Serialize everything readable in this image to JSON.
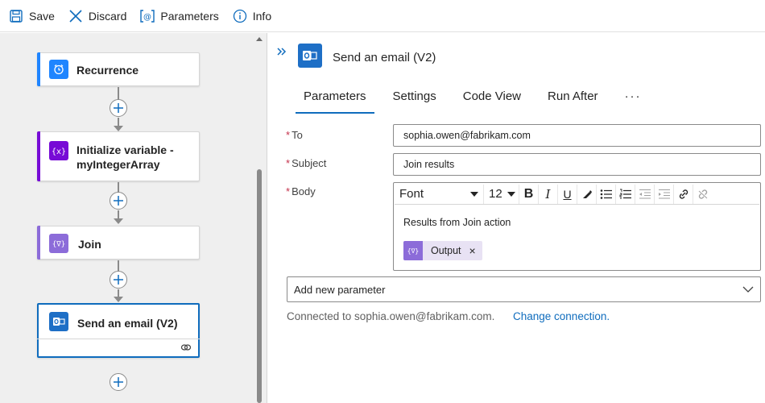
{
  "toolbar": {
    "save_label": "Save",
    "discard_label": "Discard",
    "parameters_label": "Parameters",
    "info_label": "Info"
  },
  "designer": {
    "cards": [
      {
        "title": "Recurrence",
        "icon": "clock-icon",
        "color": "#1f85ff"
      },
      {
        "title": "Initialize variable -",
        "title2": "myIntegerArray",
        "icon": "variable-icon",
        "color": "#770bd6"
      },
      {
        "title": "Join",
        "icon": "data-operation-icon",
        "color": "#8c6cd9"
      },
      {
        "title": "Send an email (V2)",
        "icon": "outlook-icon",
        "color": "#1e6fc6"
      }
    ]
  },
  "panel": {
    "title": "Send an email (V2)",
    "tabs": [
      "Parameters",
      "Settings",
      "Code View",
      "Run After",
      "···"
    ],
    "active_tab": "Parameters",
    "fields": {
      "to_label": "To",
      "to_value": "sophia.owen@fabrikam.com",
      "subject_label": "Subject",
      "subject_value": "Join results",
      "body_label": "Body",
      "required_mark": "*"
    },
    "editor": {
      "font": "Font",
      "size": "12",
      "bold": "B",
      "italic": "I",
      "underline": "U",
      "body_text": "Results from Join action",
      "token_label": "Output",
      "token_remove": "×"
    },
    "add_param": "Add new parameter",
    "connected_text": "Connected to sophia.owen@fabrikam.com.",
    "change_link": "Change connection."
  },
  "colors": {
    "accent": "#0f6cbd",
    "required": "#c4314b",
    "recurrence": "#1f85ff",
    "variable": "#770bd6",
    "join": "#8c6cd9",
    "outlook": "#1e6fc6",
    "selected_card_border": "#0f6cbd"
  }
}
